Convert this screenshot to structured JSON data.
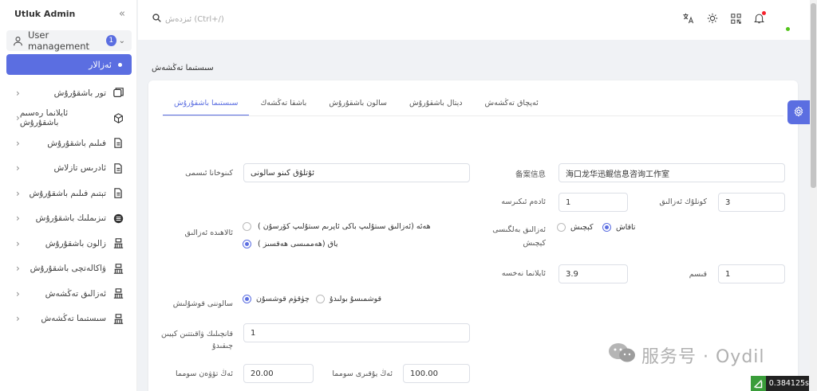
{
  "sidebar": {
    "title": "Utluk Admin",
    "user_mgmt": {
      "label": "User management",
      "badge": "1"
    },
    "active_item": "ئەزالار",
    "items": [
      {
        "label": "تور باشقۇرۇش",
        "icon": "window-icon"
      },
      {
        "label": "ئايلانما رەسىم باشقۇرۇش",
        "icon": "cube-icon"
      },
      {
        "label": "فىلىم باشقۇرۇش",
        "icon": "document-icon"
      },
      {
        "label": "ئادرىس تازلاش",
        "icon": "document-icon"
      },
      {
        "label": "تېتىم فىلىم باشقۇرۇش",
        "icon": "document-icon"
      },
      {
        "label": "تىزىملىك باشقۇرۇش",
        "icon": "list-icon"
      },
      {
        "label": "زالون باشقۇرۇش",
        "icon": "building-icon"
      },
      {
        "label": "ۋاكالەتچى باشقۇرۇش",
        "icon": "building-icon"
      },
      {
        "label": "ئەزالىق تەڭشەش",
        "icon": "building-icon"
      },
      {
        "label": "سىستىما تەڭشەش",
        "icon": "building-icon"
      }
    ]
  },
  "topbar": {
    "search_placeholder": "ئىزدەش (Ctrl+/)"
  },
  "breadcrumb": "سىستىما تەڭشەش",
  "tabs": [
    "سىستىما باشقۇرۇش",
    "باشقا تەڭشەك",
    "سالون باشقۇرۇش",
    "دېتال باشقۇرۇش",
    "ئەپچاق تەڭشەش"
  ],
  "form": {
    "cinema_name_label": "كىنوخانا ئىسمى",
    "cinema_name_value": "ئۇتلۇق كىنو سالونى",
    "icp_label": "备案信息",
    "icp_value": "海口龙华迅鲲信息咨询工作室",
    "member_count_label": "كونلۇك ئەزالىق",
    "member_count_value": "3",
    "people_label": "ئادەم ئىكىرسە",
    "people_value": "1",
    "special_label": "ئالاھىدە ئەزالىق",
    "special_opt1": "ھەئە (ئەزالىق سىتۇلىپ باكى ئاپرىم سىتۇلىپ كۆرسۇن )",
    "special_opt2": "ياق (ھەممىسى ھەقسىز )",
    "vip_label": "ئەزالىق بەلگىسى كېچىش",
    "vip_opt1": "تاقاش",
    "vip_opt2": "كېچىش",
    "rotation_label": "ئايلانما نەخسە",
    "rotation_value": "3.9",
    "part_label": "قىسم",
    "part_value": "1",
    "hall_add_label": "سالوننى قوشۇلىش",
    "hall_opt1": "چۈقۈم قوشسۇن",
    "hall_opt2": "قوشمىسۇ بولىدۇ",
    "seat_label": "قانچىلىك ۋاقىتتىن كېيىن چىقىدۇ",
    "seat_value": "1",
    "min_label": "ئەڭ تۆۋەن سومما",
    "min_value": "20.00",
    "max_label": "ئەڭ يۇقىرى سومما",
    "max_value": "100.00"
  },
  "watermark": "服务号 · Oydil",
  "perf": "0.384125s"
}
